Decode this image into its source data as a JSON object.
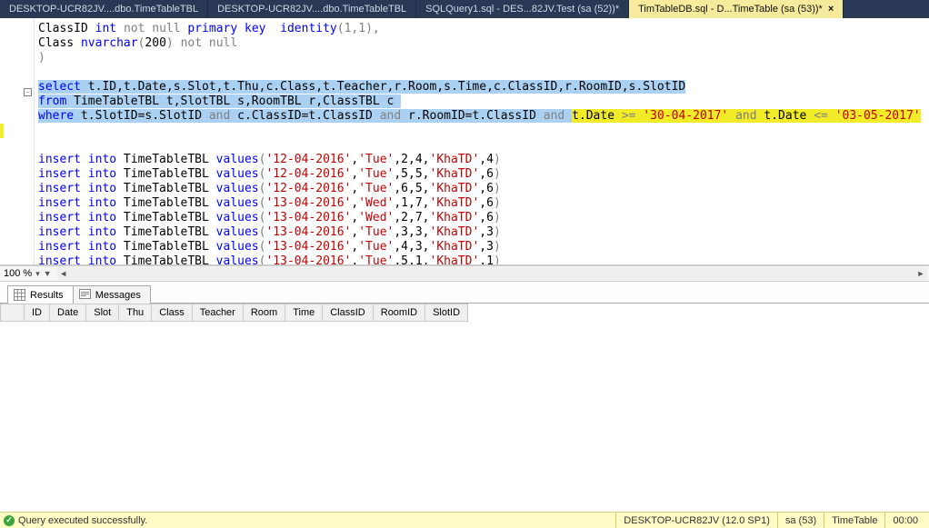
{
  "tabs": [
    {
      "label": "DESKTOP-UCR82JV....dbo.TimeTableTBL",
      "active": false
    },
    {
      "label": "DESKTOP-UCR82JV....dbo.TimeTableTBL",
      "active": false
    },
    {
      "label": "SQLQuery1.sql - DES...82JV.Test (sa (52))*",
      "active": false
    },
    {
      "label": "TimTableDB.sql - D...TimeTable (sa (53))*",
      "active": true
    }
  ],
  "editor": {
    "line1_classid": "ClassID",
    "line1_int": "int",
    "line1_notnull": "not null",
    "line1_pk": "primary key",
    "line1_identity": "identity",
    "line1_args": "(1,1),",
    "line2_class": "Class",
    "line2_nvarchar": "nvarchar",
    "line2_open": "(",
    "line2_size": "200",
    "line2_close": ")",
    "line2_notnull": "not null",
    "line3_paren": ")",
    "sel_select": "select",
    "sel_cols": " t.ID,t.Date,s.Slot,t.Thu,c.Class,t.Teacher,r.Room,s.Time,c.ClassID,r.RoomID,s.SlotID",
    "sel_from": "from",
    "sel_from_rest": " TimeTableTBL t,SlotTBL s,RoomTBL r,ClassTBL c",
    "sel_where": "where",
    "sel_w1": " t.SlotID=s.SlotID ",
    "sel_and": "and",
    "sel_w2": " c.ClassID=t.ClassID ",
    "sel_w3": " r.RoomID=t.ClassID ",
    "hl_date1": "t.Date",
    "hl_ge": " >= ",
    "hl_d1": "'30-04-2017'",
    "hl_and": " and ",
    "hl_date2": "t.Date",
    "hl_le": " <= ",
    "hl_d2": "'03-05-2017'",
    "ins_kw": "insert into",
    "ins_tbl": " TimeTableTBL ",
    "ins_values_kw": "values",
    "ins_open": "(",
    "ins_close": ")",
    "inserts": [
      {
        "d": "'12-04-2016'",
        "day": "'Tue'",
        "a": "2",
        "b": "4",
        "t": "'KhaTD'",
        "c": "4"
      },
      {
        "d": "'12-04-2016'",
        "day": "'Tue'",
        "a": "5",
        "b": "5",
        "t": "'KhaTD'",
        "c": "6"
      },
      {
        "d": "'12-04-2016'",
        "day": "'Tue'",
        "a": "6",
        "b": "5",
        "t": "'KhaTD'",
        "c": "6"
      },
      {
        "d": "'13-04-2016'",
        "day": "'Wed'",
        "a": "1",
        "b": "7",
        "t": "'KhaTD'",
        "c": "6"
      },
      {
        "d": "'13-04-2016'",
        "day": "'Wed'",
        "a": "2",
        "b": "7",
        "t": "'KhaTD'",
        "c": "6"
      },
      {
        "d": "'13-04-2016'",
        "day": "'Tue'",
        "a": "3",
        "b": "3",
        "t": "'KhaTD'",
        "c": "3"
      },
      {
        "d": "'13-04-2016'",
        "day": "'Tue'",
        "a": "4",
        "b": "3",
        "t": "'KhaTD'",
        "c": "3"
      },
      {
        "d": "'13-04-2016'",
        "day": "'Tue'",
        "a": "5",
        "b": "1",
        "t": "'KhaTD'",
        "c": "1"
      }
    ]
  },
  "zoom": {
    "label": "100 %"
  },
  "results_tabs": {
    "results": "Results",
    "messages": "Messages"
  },
  "grid_columns": [
    "ID",
    "Date",
    "Slot",
    "Thu",
    "Class",
    "Teacher",
    "Room",
    "Time",
    "ClassID",
    "RoomID",
    "SlotID"
  ],
  "status": {
    "msg": "Query executed successfully.",
    "server": "DESKTOP-UCR82JV (12.0 SP1)",
    "user": "sa (53)",
    "db": "TimeTable",
    "time": "00:00"
  }
}
